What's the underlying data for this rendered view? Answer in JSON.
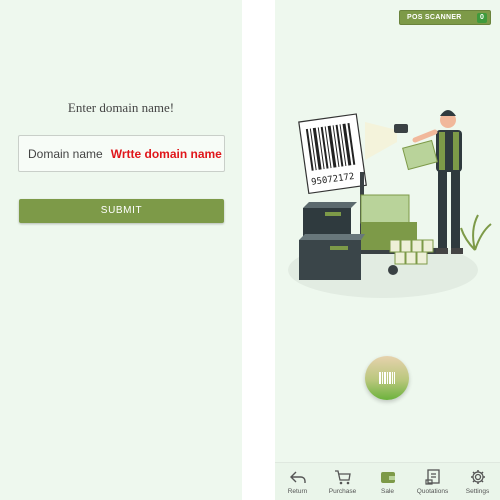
{
  "domain_screen": {
    "heading": "Enter domain name!",
    "input_label": "Domain name",
    "input_value": "Wrtte domain name",
    "submit_label": "SUBMIT"
  },
  "sale_screen": {
    "pos_scanner": {
      "label": "POS SCANNER",
      "count": "0"
    },
    "barcode_number": "95072172",
    "scan_button_icon": "barcode-icon",
    "nav": [
      {
        "label": "Return",
        "icon": "return-icon"
      },
      {
        "label": "Purchase",
        "icon": "cart-icon"
      },
      {
        "label": "Sale",
        "icon": "wallet-icon",
        "active": true
      },
      {
        "label": "Quotations",
        "icon": "quotation-icon"
      },
      {
        "label": "Settings",
        "icon": "gear-icon"
      }
    ]
  },
  "colors": {
    "background": "#eef8ee",
    "accent": "#7d9a48",
    "error_text": "#e0161b",
    "badge": "#3f9a3c"
  }
}
